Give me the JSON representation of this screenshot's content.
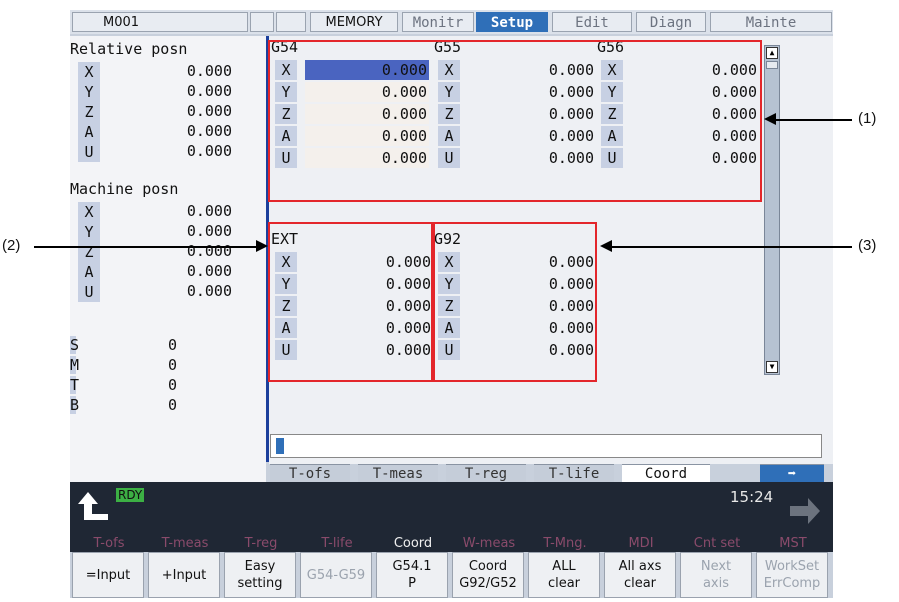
{
  "topbar": {
    "program": "M001",
    "mode": "MEMORY",
    "tabs": [
      "Monitr",
      "Setup",
      "Edit",
      "Diagn",
      "Mainte"
    ],
    "active_tab": "Setup"
  },
  "left": {
    "relative_title": "Relative posn",
    "machine_title": "Machine posn",
    "axes": [
      "X",
      "Y",
      "Z",
      "A",
      "U"
    ],
    "relative_values": [
      "0.000",
      "0.000",
      "0.000",
      "0.000",
      "0.000"
    ],
    "machine_values": [
      "0.000",
      "0.000",
      "0.000",
      "0.000",
      "0.000"
    ],
    "codes": [
      {
        "label": "S",
        "value": "0"
      },
      {
        "label": "M",
        "value": "0"
      },
      {
        "label": "T",
        "value": "0"
      },
      {
        "label": "B",
        "value": "0"
      }
    ]
  },
  "main": {
    "g54": {
      "title": "G54",
      "values": [
        "0.000",
        "0.000",
        "0.000",
        "0.000",
        "0.000"
      ]
    },
    "g55": {
      "title": "G55",
      "values": [
        "0.000",
        "0.000",
        "0.000",
        "0.000",
        "0.000"
      ]
    },
    "g56": {
      "title": "G56",
      "values": [
        "0.000",
        "0.000",
        "0.000",
        "0.000",
        "0.000"
      ]
    },
    "ext": {
      "title": "EXT",
      "values": [
        "0.000",
        "0.000",
        "0.000",
        "0.000",
        "0.000"
      ]
    },
    "g92": {
      "title": "G92",
      "values": [
        "0.000",
        "0.000",
        "0.000",
        "0.000",
        "0.000"
      ]
    }
  },
  "bottom_tabs": [
    "T-ofs",
    "T-meas",
    "T-reg",
    "T-life",
    "Coord"
  ],
  "active_bottom_tab": "Coord",
  "status": {
    "ready": "RDY",
    "clock": "15:24"
  },
  "menu_labels": [
    "T-ofs",
    "T-meas",
    "T-reg",
    "T-life",
    "Coord",
    "W-meas",
    "T-Mng.",
    "MDI",
    "Cnt set",
    "MST"
  ],
  "softkeys": [
    {
      "l1": "=Input",
      "l2": ""
    },
    {
      "l1": "+Input",
      "l2": ""
    },
    {
      "l1": "Easy",
      "l2": "setting"
    },
    {
      "l1": "G54-G59",
      "l2": ""
    },
    {
      "l1": "G54.1",
      "l2": "P"
    },
    {
      "l1": "Coord",
      "l2": "G92/G52"
    },
    {
      "l1": "ALL",
      "l2": "clear"
    },
    {
      "l1": "All axs",
      "l2": "clear"
    },
    {
      "l1": "Next",
      "l2": "axis"
    },
    {
      "l1": "WorkSet",
      "l2": "ErrComp"
    }
  ],
  "annotations": [
    "(1)",
    "(2)",
    "(3)"
  ],
  "colors": {
    "active_tab": "#2f6fb8",
    "highlight_field": "#4a64c0",
    "annotation_box": "#e3262b",
    "ready": "#3cb044"
  }
}
